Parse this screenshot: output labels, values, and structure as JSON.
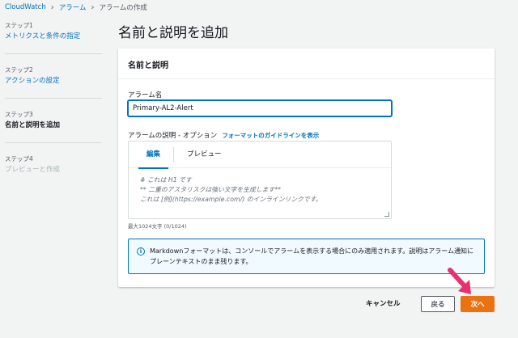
{
  "breadcrumb": {
    "items": [
      "CloudWatch",
      "アラーム"
    ],
    "current": "アラームの作成"
  },
  "steps": [
    {
      "num": "ステップ1",
      "title": "メトリクスと条件の指定",
      "state": "link"
    },
    {
      "num": "ステップ2",
      "title": "アクションの設定",
      "state": "link"
    },
    {
      "num": "ステップ3",
      "title": "名前と説明を追加",
      "state": "active"
    },
    {
      "num": "ステップ4",
      "title": "プレビューと作成",
      "state": "disabled"
    }
  ],
  "page_title": "名前と説明を追加",
  "panel": {
    "header": "名前と説明",
    "name_label": "アラーム名",
    "name_value": "Primary-AL2-Alert",
    "desc_label": "アラームの説明 - オプション",
    "guide_link": "フォーマットのガイドラインを表示",
    "tabs": {
      "edit": "編集",
      "preview": "プレビュー"
    },
    "placeholder_lines": [
      "# これは H1 です",
      "** 二重のアスタリスクは強い文字を生成します**",
      "これは [例](https://example.com/) のインラインリンクです。"
    ],
    "char_count": "最大1024文字 (0/1024)",
    "info_text": "Markdownフォーマットは、コンソールでアラームを表示する場合にのみ適用されます。説明はアラーム通知にプレーンテキストのまま残ります。"
  },
  "footer": {
    "cancel": "キャンセル",
    "back": "戻る",
    "next": "次へ"
  },
  "colors": {
    "link": "#0073bb",
    "primary": "#ec7211",
    "pointer": "#e8306e"
  }
}
